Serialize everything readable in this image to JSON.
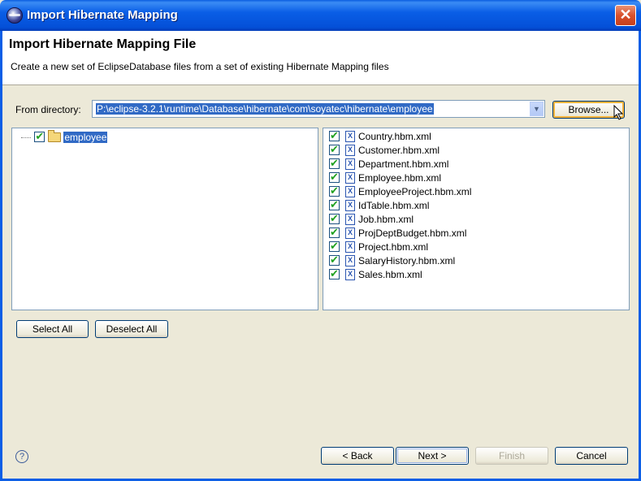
{
  "window": {
    "title": "Import Hibernate Mapping",
    "close_label": "✕"
  },
  "header": {
    "title": "Import Hibernate Mapping File",
    "description": "Create a new set of EclipseDatabase files from a set of existing Hibernate Mapping files"
  },
  "directory": {
    "label": "From directory:",
    "value": "P:\\eclipse-3.2.1\\runtime\\Database\\hibernate\\com\\soyatec\\hibernate\\employee",
    "browse_label": "Browse..."
  },
  "tree": {
    "items": [
      {
        "label": "employee",
        "checked": true
      }
    ]
  },
  "files": [
    {
      "label": "Country.hbm.xml",
      "checked": true
    },
    {
      "label": "Customer.hbm.xml",
      "checked": true
    },
    {
      "label": "Department.hbm.xml",
      "checked": true
    },
    {
      "label": "Employee.hbm.xml",
      "checked": true
    },
    {
      "label": "EmployeeProject.hbm.xml",
      "checked": true
    },
    {
      "label": "IdTable.hbm.xml",
      "checked": true
    },
    {
      "label": "Job.hbm.xml",
      "checked": true
    },
    {
      "label": "ProjDeptBudget.hbm.xml",
      "checked": true
    },
    {
      "label": "Project.hbm.xml",
      "checked": true
    },
    {
      "label": "SalaryHistory.hbm.xml",
      "checked": true
    },
    {
      "label": "Sales.hbm.xml",
      "checked": true
    }
  ],
  "selection_buttons": {
    "select_all": "Select All",
    "deselect_all": "Deselect All"
  },
  "footer": {
    "help_icon": "?",
    "back": "< Back",
    "next": "Next >",
    "finish": "Finish",
    "cancel": "Cancel"
  },
  "colors": {
    "titlebar": "#0a5ee6",
    "selection": "#316ac5",
    "dialog_bg": "#ece9d8"
  }
}
